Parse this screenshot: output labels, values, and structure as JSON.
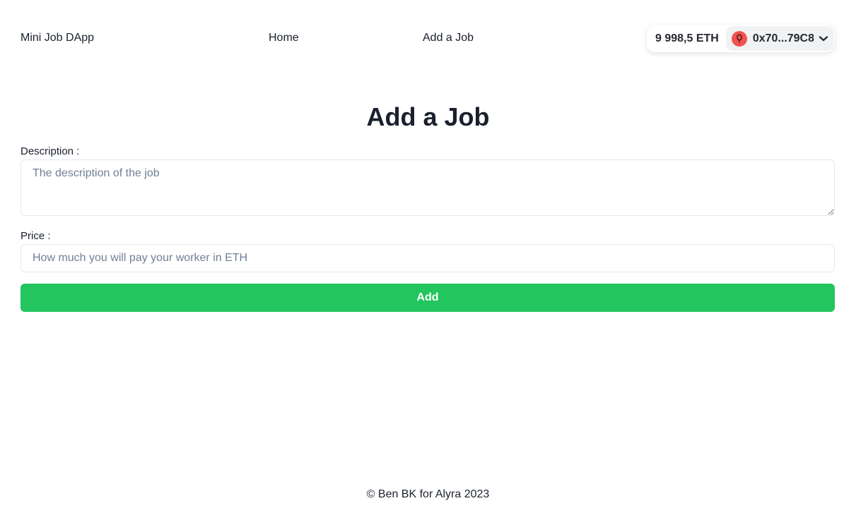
{
  "header": {
    "brand": "Mini Job DApp",
    "nav": {
      "home": "Home",
      "add_job": "Add a Job"
    },
    "wallet": {
      "balance": "9 998,5 ETH",
      "address": "0x70...79C8",
      "avatar_color": "#ef5350",
      "avatar_icon": "balloon-icon",
      "dropdown_icon": "chevron-down-icon"
    }
  },
  "main": {
    "title": "Add a Job",
    "description": {
      "label": "Description :",
      "placeholder": "The description of the job",
      "value": ""
    },
    "price": {
      "label": "Price :",
      "placeholder": "How much you will pay your worker in ETH",
      "value": ""
    },
    "submit_label": "Add",
    "submit_color": "#22c55e"
  },
  "footer": {
    "text": "© Ben BK for Alyra 2023"
  }
}
